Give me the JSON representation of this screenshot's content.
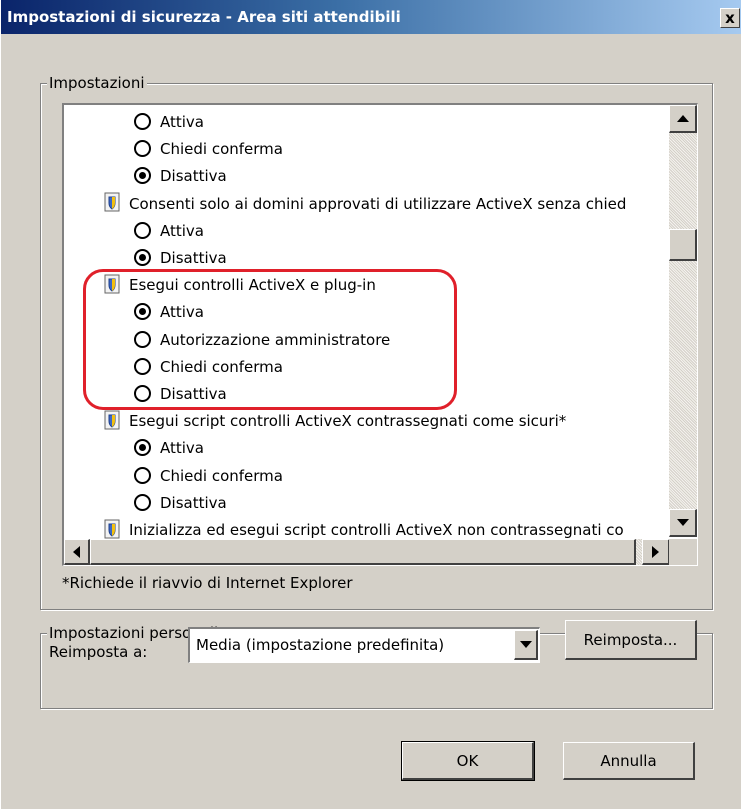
{
  "window": {
    "title": "Impostazioni di sicurezza - Area siti attendibili",
    "close_symbol": "x"
  },
  "settings_group": {
    "legend": "Impostazioni",
    "rows": [
      {
        "kind": "radio",
        "label": "Attiva",
        "checked": false
      },
      {
        "kind": "radio",
        "label": "Chiedi conferma",
        "checked": false
      },
      {
        "kind": "radio",
        "label": "Disattiva",
        "checked": true
      },
      {
        "kind": "category",
        "label": "Consenti solo ai domini approvati di utilizzare ActiveX senza chied"
      },
      {
        "kind": "radio",
        "label": "Attiva",
        "checked": false
      },
      {
        "kind": "radio",
        "label": "Disattiva",
        "checked": true
      },
      {
        "kind": "category",
        "label": "Esegui controlli ActiveX e plug-in"
      },
      {
        "kind": "radio",
        "label": "Attiva",
        "checked": true
      },
      {
        "kind": "radio",
        "label": "Autorizzazione amministratore",
        "checked": false
      },
      {
        "kind": "radio",
        "label": "Chiedi conferma",
        "checked": false
      },
      {
        "kind": "radio",
        "label": "Disattiva",
        "checked": false
      },
      {
        "kind": "category",
        "label": "Esegui script controlli ActiveX contrassegnati come sicuri*"
      },
      {
        "kind": "radio",
        "label": "Attiva",
        "checked": true
      },
      {
        "kind": "radio",
        "label": "Chiedi conferma",
        "checked": false
      },
      {
        "kind": "radio",
        "label": "Disattiva",
        "checked": false
      },
      {
        "kind": "category",
        "label": "Inizializza ed esegui script controlli ActiveX non contrassegnati co"
      }
    ],
    "note": "*Richiede il riavvio di Internet Explorer"
  },
  "custom_group": {
    "legend": "Impostazioni personalizzate",
    "reset_label": "Reimposta a:",
    "reset_value": "Media (impostazione predefinita)",
    "reset_button": "Reimposta..."
  },
  "footer": {
    "ok_label": "OK",
    "cancel_label": "Annulla"
  },
  "colors": {
    "highlight": "#e0202a",
    "titlebar_start": "#0a246a",
    "titlebar_end": "#a6caf0"
  },
  "icons": {
    "category": "activex-shield-icon",
    "close": "close-icon"
  }
}
